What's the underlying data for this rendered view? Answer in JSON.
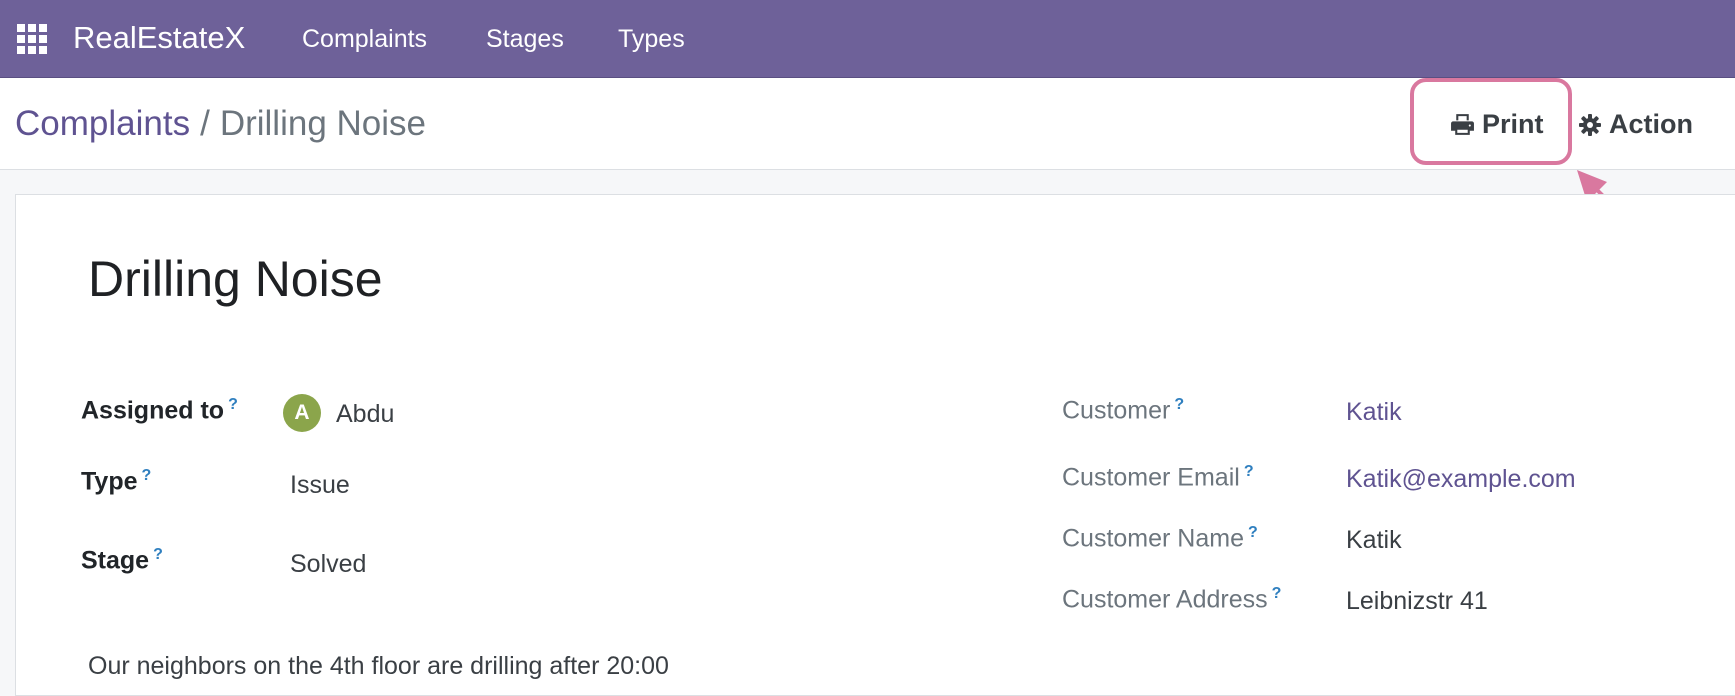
{
  "navbar": {
    "apps_icon": "grid-icon",
    "brand": "RealEstateX",
    "menu": [
      "Complaints",
      "Stages",
      "Types"
    ],
    "background": "#6e6199"
  },
  "breadcrumb": {
    "parent": "Complaints",
    "separator": "/",
    "current": "Drilling Noise"
  },
  "actions": {
    "print_label": "Print",
    "print_icon": "printer-icon",
    "action_label": "Action",
    "action_icon": "gear-icon"
  },
  "annotation": {
    "color": "#d9789f",
    "target": "Print"
  },
  "record": {
    "title": "Drilling Noise",
    "help_mark": "?",
    "left_fields": [
      {
        "label": "Assigned to",
        "value": "Abdu",
        "avatar_initial": "A"
      },
      {
        "label": "Type",
        "value": "Issue"
      },
      {
        "label": "Stage",
        "value": "Solved"
      }
    ],
    "right_fields": [
      {
        "label": "Customer",
        "value": "Katik"
      },
      {
        "label": "Customer Email",
        "value": "Katik@example.com"
      },
      {
        "label": "Customer Name",
        "value": "Katik"
      },
      {
        "label": "Customer Address",
        "value": "Leibnizstr 41"
      }
    ],
    "description": "Our neighbors on the 4th floor are drilling after 20:00"
  }
}
